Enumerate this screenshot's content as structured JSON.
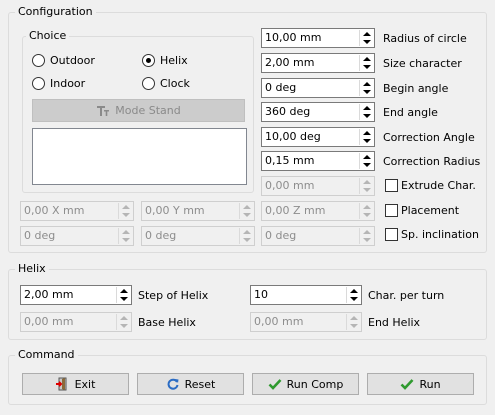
{
  "configuration": {
    "title": "Configuration",
    "choice": {
      "title": "Choice",
      "radios": [
        {
          "label": "Outdoor",
          "checked": false
        },
        {
          "label": "Helix",
          "checked": true
        },
        {
          "label": "Indoor",
          "checked": false
        },
        {
          "label": "Clock",
          "checked": false
        }
      ],
      "mode_stand_label": "Mode Stand"
    },
    "params": [
      {
        "value": "10,00 mm",
        "label": "Radius of circle"
      },
      {
        "value": "2,00 mm",
        "label": "Size character"
      },
      {
        "value": "0 deg",
        "label": "Begin angle"
      },
      {
        "value": "360 deg",
        "label": "End angle"
      },
      {
        "value": "10,00 deg",
        "label": "Correction Angle"
      },
      {
        "value": "0,15 mm",
        "label": "Correction Radius"
      }
    ],
    "extrude_value": "0,00 mm",
    "extrude_label": "Extrude Char.",
    "placement_label": "Placement",
    "sp_inclination_label": "Sp. inclination",
    "pos": {
      "x": "0,00 X mm",
      "y": "0,00 Y mm",
      "z": "0,00 Z mm"
    },
    "angles": {
      "a": "0 deg",
      "b": "0 deg",
      "c": "0 deg"
    }
  },
  "helix": {
    "title": "Helix",
    "step_value": "2,00 mm",
    "step_label": "Step of Helix",
    "char_turn_value": "10",
    "char_turn_label": "Char. per turn",
    "base_value": "0,00 mm",
    "base_label": "Base Helix",
    "end_value": "0,00 mm",
    "end_label": "End Helix"
  },
  "command": {
    "title": "Command",
    "exit_label": "Exit",
    "reset_label": "Reset",
    "run_comp_label": "Run Comp",
    "run_label": "Run"
  }
}
